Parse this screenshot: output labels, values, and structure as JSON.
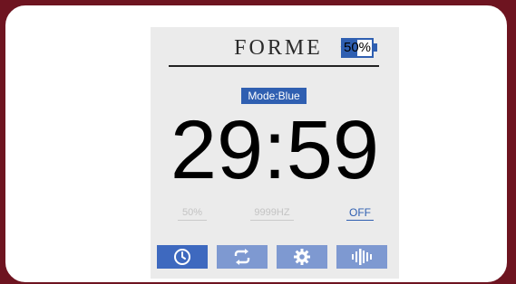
{
  "header": {
    "brand": "FORME",
    "trademark": "™",
    "battery": {
      "label": "50%",
      "level": 0.5,
      "color": "#2f5fb1"
    }
  },
  "mode": {
    "label": "Mode:Blue",
    "color": "#2f5fb1"
  },
  "timer": {
    "value": "29:59"
  },
  "metrics": {
    "intensity": "50%",
    "frequency": "9999HZ",
    "state": "OFF"
  },
  "tabs": [
    {
      "icon": "clock-icon",
      "active": true
    },
    {
      "icon": "repeat-icon",
      "active": false
    },
    {
      "icon": "settings-icon",
      "active": false
    },
    {
      "icon": "vibration-icon",
      "active": false
    }
  ],
  "colors": {
    "accent": "#2f5fb1",
    "tab_inactive": "#7e99d1",
    "tab_active": "#3e69bf",
    "frame": "#6e1420"
  }
}
